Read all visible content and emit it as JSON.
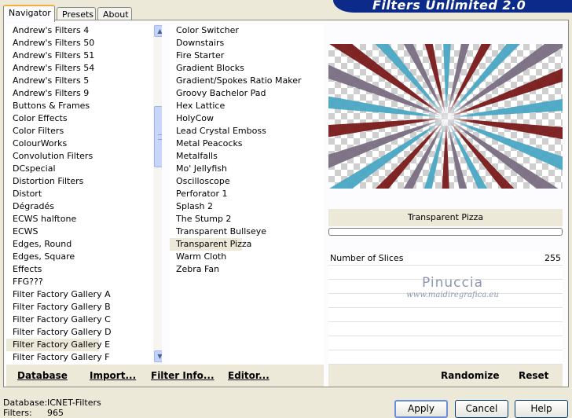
{
  "app": {
    "title": "Filters Unlimited 2.0"
  },
  "tabs": [
    {
      "label": "Navigator",
      "active": true
    },
    {
      "label": "Presets",
      "active": false
    },
    {
      "label": "About",
      "active": false
    }
  ],
  "categories": {
    "selected": "Filter Factory Gallery E",
    "items": [
      "Andrew's Filters 4",
      "Andrew's Filters 50",
      "Andrew's Filters 51",
      "Andrew's Filters 54",
      "Andrew's Filters 5",
      "Andrew's Filters 9",
      "Buttons & Frames",
      "Color Effects",
      "Color Filters",
      "ColourWorks",
      "Convolution Filters",
      "DCspecial",
      "Distortion Filters",
      "Distort",
      "Dégradés",
      "ECWS halftone",
      "ECWS",
      "Edges, Round",
      "Edges, Square",
      "Effects",
      "FFG???",
      "Filter Factory Gallery A",
      "Filter Factory Gallery B",
      "Filter Factory Gallery C",
      "Filter Factory Gallery D",
      "Filter Factory Gallery E",
      "Filter Factory Gallery F"
    ]
  },
  "filters": {
    "selected": "Transparent Pizza",
    "items": [
      "Color Switcher",
      "Downstairs",
      "Fire Starter",
      "Gradient Blocks",
      "Gradient/Spokes Ratio Maker",
      "Groovy Bachelor Pad",
      "Hex Lattice",
      "HolyCow",
      "Lead Crystal Emboss",
      "Metal Peacocks",
      "Metalfalls",
      "Mo' Jellyfish",
      "Oscilloscope",
      "Perforator 1",
      "Splash 2",
      "The Stump 2",
      "Transparent Bullseye",
      "Transparent Pizza",
      "Warm Cloth",
      "Zebra Fan"
    ]
  },
  "toolbar": {
    "database": "Database",
    "import": "Import...",
    "filter_info": "Filter Info...",
    "editor": "Editor..."
  },
  "preview": {
    "filter_name": "Transparent Pizza",
    "colors": {
      "red": "#7a1a1a",
      "blue": "#4aa7c4",
      "mauve": "#7a6e82"
    },
    "progress": 0
  },
  "params": [
    {
      "name": "Number of Slices",
      "value": "255"
    }
  ],
  "watermark": {
    "name": "Pinuccia",
    "url": "www.maidiregrafica.eu"
  },
  "right_toolbar": {
    "randomize": "Randomize",
    "reset": "Reset"
  },
  "status": {
    "database_label": "Database:",
    "database_value": "ICNET-Filters",
    "filters_label": "Filters:",
    "filters_value": "965"
  },
  "dialog": {
    "apply": "Apply",
    "cancel": "Cancel",
    "help": "Help"
  }
}
